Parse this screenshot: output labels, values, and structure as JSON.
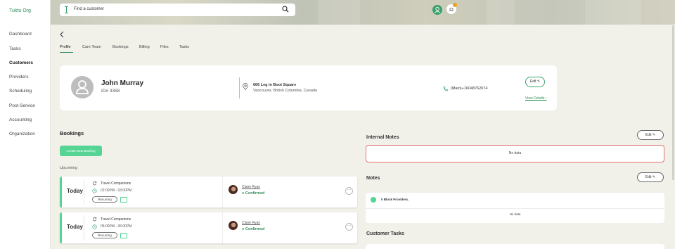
{
  "sidebar": {
    "org_name": "Tuktu Org",
    "items": [
      {
        "label": "Dashboard"
      },
      {
        "label": "Tasks"
      },
      {
        "label": "Customers",
        "active": true
      },
      {
        "label": "Providers"
      },
      {
        "label": "Scheduling"
      },
      {
        "label": "Post-Service"
      },
      {
        "label": "Accounting"
      },
      {
        "label": "Organization"
      }
    ]
  },
  "header": {
    "search_placeholder": "Find a customer",
    "icons": [
      "search-icon",
      "user-icon",
      "bell-icon"
    ],
    "colors": {
      "accent": "#3aa06b",
      "badge": "#f0a020"
    }
  },
  "tabs": [
    {
      "label": "Profile",
      "active": true
    },
    {
      "label": "Care Team"
    },
    {
      "label": "Bookings"
    },
    {
      "label": "Billing"
    },
    {
      "label": "Files"
    },
    {
      "label": "Tasks"
    }
  ],
  "profile": {
    "name": "John Murray",
    "id": "ID# 3358",
    "address_line1": "666 Leg in Boot Square",
    "address_line2": "Vancouver, British Columbia, Canada",
    "phone": "(Main)+16048762074",
    "edit_label": "Edit",
    "view_details": "View Details"
  },
  "bookings": {
    "title": "Bookings",
    "create_label": "Create New Booking",
    "upcoming_label": "Upcoming",
    "items": [
      {
        "day": "Today",
        "title": "Travel Companions",
        "time": "02:00PM - 03:00PM",
        "recurring": "Recurring",
        "provider": "Claire Ryan",
        "status": "Confirmed"
      },
      {
        "day": "Today",
        "title": "Travel Companions",
        "time": "05:00PM - 06:00PM",
        "recurring": "Recurring",
        "provider": "Claire Ryan",
        "status": "Confirmed"
      }
    ]
  },
  "internal_notes": {
    "title": "Internal Notes",
    "edit_label": "Edit",
    "empty": "No data"
  },
  "notes": {
    "title": "Notes",
    "edit_label": "Edit",
    "block_providers": "0 Block Providers.",
    "empty": "No data"
  },
  "customer_tasks": {
    "title": "Customer Tasks"
  }
}
